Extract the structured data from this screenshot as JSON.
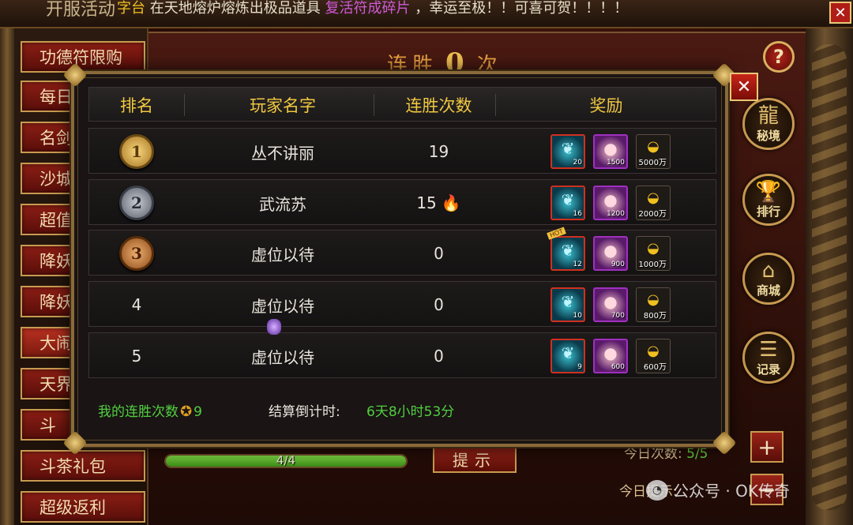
{
  "top": {
    "title": "开服活动",
    "marquee_pre": "字台",
    "marquee_mid": "在天地熔炉熔炼出极品道具",
    "marquee_item": "复活符成碎片",
    "marquee_post": "，幸运至极！！可喜可贺！！！！",
    "close": "✕"
  },
  "left_menu": [
    {
      "label": "功德符限购",
      "active": false
    },
    {
      "label": "每日",
      "active": false
    },
    {
      "label": "名剑",
      "active": false
    },
    {
      "label": "沙城",
      "active": false
    },
    {
      "label": "超值",
      "active": false
    },
    {
      "label": "降妖",
      "active": false
    },
    {
      "label": "降妖",
      "active": false
    },
    {
      "label": "大闹",
      "active": true
    },
    {
      "label": "天界",
      "active": false
    },
    {
      "label": "斗",
      "active": false
    },
    {
      "label": "斗茶礼包",
      "active": false
    },
    {
      "label": "超级返利",
      "active": false
    }
  ],
  "panel": {
    "streak_prefix": "连胜",
    "streak_value": "0",
    "streak_suffix": "次",
    "help": "?",
    "progress_text": "4/4",
    "progress_fraction": 1.0,
    "tip_button": "提示",
    "today_label": "今日次数:",
    "today_value": "5/5",
    "plus": "+",
    "minus": "−",
    "hint": "今日提示:"
  },
  "right_icons": [
    {
      "name": "secret-realm",
      "glyph": "龍",
      "label": "秘境"
    },
    {
      "name": "ranking",
      "glyph": "🏆",
      "label": "排行"
    },
    {
      "name": "shop",
      "glyph": "⌂",
      "label": "商城"
    },
    {
      "name": "record",
      "glyph": "☰",
      "label": "记录"
    }
  ],
  "modal": {
    "close": "✕",
    "headers": {
      "rank": "排名",
      "player": "玩家名字",
      "streak": "连胜次数",
      "reward": "奖励"
    },
    "rows": [
      {
        "rank": "1",
        "medal": "gold",
        "player": "丛不讲丽",
        "streak": "19",
        "flame": false,
        "tag": "",
        "rewards": {
          "spirit": "20",
          "peach": "1500",
          "gold": "5000万"
        }
      },
      {
        "rank": "2",
        "medal": "silver",
        "player": "武流苏",
        "streak": "15",
        "flame": true,
        "tag": "",
        "rewards": {
          "spirit": "16",
          "peach": "1200",
          "gold": "2000万"
        }
      },
      {
        "rank": "3",
        "medal": "bronze",
        "player": "虚位以待",
        "streak": "0",
        "flame": false,
        "tag": "HOT",
        "rewards": {
          "spirit": "12",
          "peach": "900",
          "gold": "1000万"
        }
      },
      {
        "rank": "4",
        "medal": "",
        "player": "虚位以待",
        "streak": "0",
        "flame": false,
        "tag": "",
        "rewards": {
          "spirit": "10",
          "peach": "700",
          "gold": "800万"
        }
      },
      {
        "rank": "5",
        "medal": "",
        "player": "虚位以待",
        "streak": "0",
        "flame": false,
        "tag": "",
        "rewards": {
          "spirit": "9",
          "peach": "600",
          "gold": "600万"
        }
      }
    ],
    "footer": {
      "my_streak_label": "我的连胜次数",
      "my_streak_value": "9",
      "countdown_label": "结算倒计时:",
      "countdown_value": "6天8小时53分"
    }
  },
  "watermark": "公众号 · OK传奇",
  "colors": {
    "gold_text": "#f0c840",
    "green_text": "#50d040",
    "accent_red": "#b01c16"
  }
}
